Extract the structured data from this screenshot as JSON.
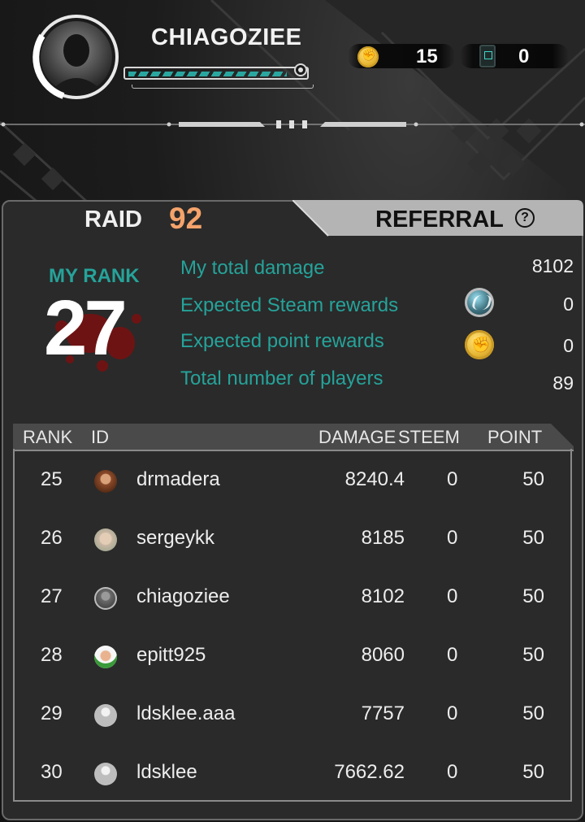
{
  "header": {
    "username": "CHIAGOZIEE",
    "xp_fraction": 0.92,
    "coins": "15",
    "cards": "0"
  },
  "raid": {
    "label": "RAID",
    "number": "92",
    "referral_label": "REFERRAL",
    "help_symbol": "?"
  },
  "my_rank": {
    "label": "MY RANK",
    "value": "27"
  },
  "stats": [
    {
      "label": "My total damage",
      "value": "8102"
    },
    {
      "label": "Expected Steam rewards",
      "value": "0",
      "icon": "steem-icon"
    },
    {
      "label": "Expected point rewards",
      "value": "0",
      "icon": "point-coin-icon"
    },
    {
      "label": "Total number of players",
      "value": "89"
    }
  ],
  "table": {
    "headers": {
      "rank": "RANK",
      "id": "ID",
      "damage": "DAMAGE",
      "steem": "STEEM",
      "point": "POINT"
    },
    "rows": [
      {
        "rank": "25",
        "id": "drmadera",
        "damage": "8240.4",
        "steem": "0",
        "point": "50",
        "avatar_color": "#8a4a2a"
      },
      {
        "rank": "26",
        "id": "sergeykk",
        "damage": "8185",
        "steem": "0",
        "point": "50",
        "avatar_color": "#c9b7a3"
      },
      {
        "rank": "27",
        "id": "chiagoziee",
        "damage": "8102",
        "steem": "0",
        "point": "50",
        "avatar_color": "#6a6a6a"
      },
      {
        "rank": "28",
        "id": "epitt925",
        "damage": "8060",
        "steem": "0",
        "point": "50",
        "avatar_color": "#f4f4f4"
      },
      {
        "rank": "29",
        "id": "ldsklee.aaa",
        "damage": "7757",
        "steem": "0",
        "point": "50",
        "avatar_color": "generic"
      },
      {
        "rank": "30",
        "id": "ldsklee",
        "damage": "7662.62",
        "steem": "0",
        "point": "50",
        "avatar_color": "generic"
      }
    ]
  },
  "colors": {
    "accent_teal": "#25a39a",
    "raid_orange": "#f5a36b",
    "panel_bg": "#2a2a2a"
  }
}
